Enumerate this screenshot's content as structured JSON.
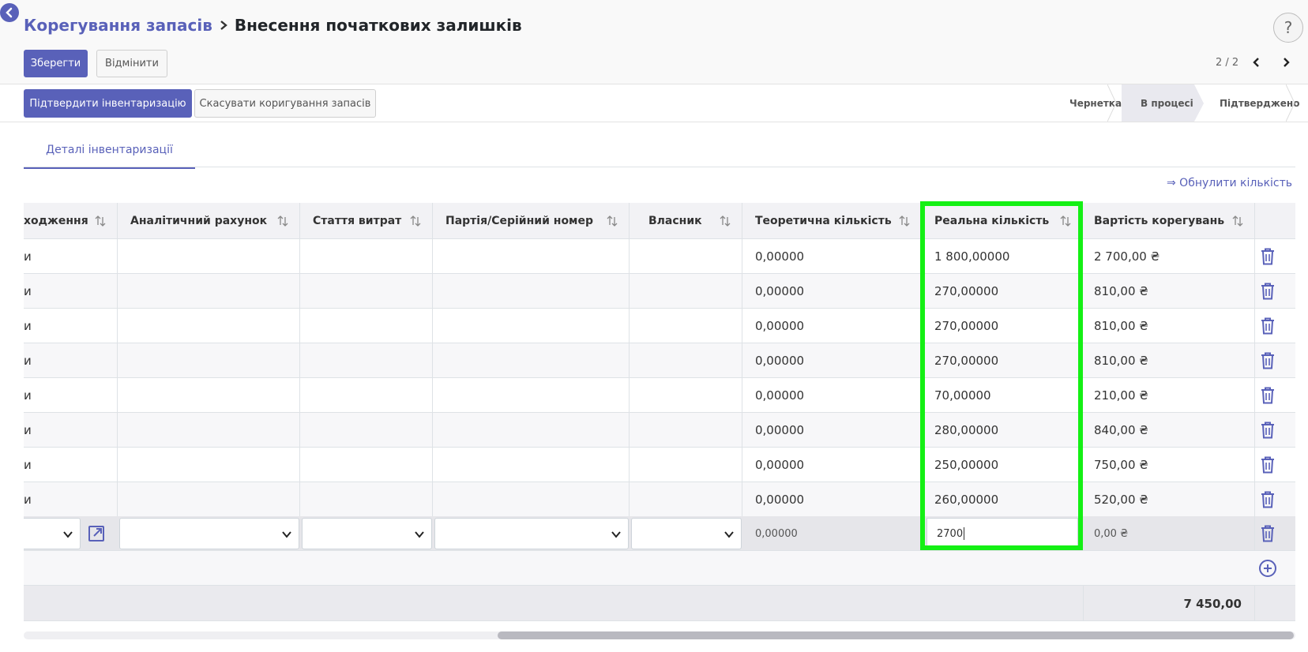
{
  "breadcrumb": {
    "parent": "Корегування запасів",
    "current": "Внесення початкових залишків"
  },
  "actions": {
    "save": "Зберегти",
    "discard": "Відмінити"
  },
  "pager": {
    "text": "2 / 2"
  },
  "help": "?",
  "statusbar": {
    "confirm": "Підтвердити інвентаризацію",
    "cancel": "Скасувати коригування запасів",
    "stages": [
      "Чернетка",
      "В процесі",
      "Підтверджено"
    ],
    "active_stage": "В процесі"
  },
  "tabs": {
    "details": "Деталі інвентаризації"
  },
  "reset_quantity": "⇒ Обнулити кількість",
  "table": {
    "headers": {
      "location": "ходження",
      "analytic": "Аналітичний рахунок",
      "expense": "Стаття витрат",
      "lot": "Партія/Серійний номер",
      "owner": "Власник",
      "theoretical": "Теоретична кількість",
      "real": "Реальна кількість",
      "cost": "Вартість корегувань"
    },
    "rows": [
      {
        "location": "и",
        "theoretical": "0,00000",
        "real": "1 800,00000",
        "cost": "2 700,00 ₴"
      },
      {
        "location": "и",
        "theoretical": "0,00000",
        "real": "270,00000",
        "cost": "810,00 ₴"
      },
      {
        "location": "и",
        "theoretical": "0,00000",
        "real": "270,00000",
        "cost": "810,00 ₴"
      },
      {
        "location": "и",
        "theoretical": "0,00000",
        "real": "270,00000",
        "cost": "810,00 ₴"
      },
      {
        "location": "и",
        "theoretical": "0,00000",
        "real": "70,00000",
        "cost": "210,00 ₴"
      },
      {
        "location": "и",
        "theoretical": "0,00000",
        "real": "280,00000",
        "cost": "840,00 ₴"
      },
      {
        "location": "и",
        "theoretical": "0,00000",
        "real": "250,00000",
        "cost": "750,00 ₴"
      },
      {
        "location": "и",
        "theoretical": "0,00000",
        "real": "260,00000",
        "cost": "520,00 ₴"
      }
    ],
    "edit_row": {
      "theoretical": "0,00000",
      "real_input": "2700",
      "cost": "0,00 ₴"
    },
    "total": "7 450,00"
  },
  "colors": {
    "accent": "#5961b9",
    "highlight": "#14f014"
  }
}
